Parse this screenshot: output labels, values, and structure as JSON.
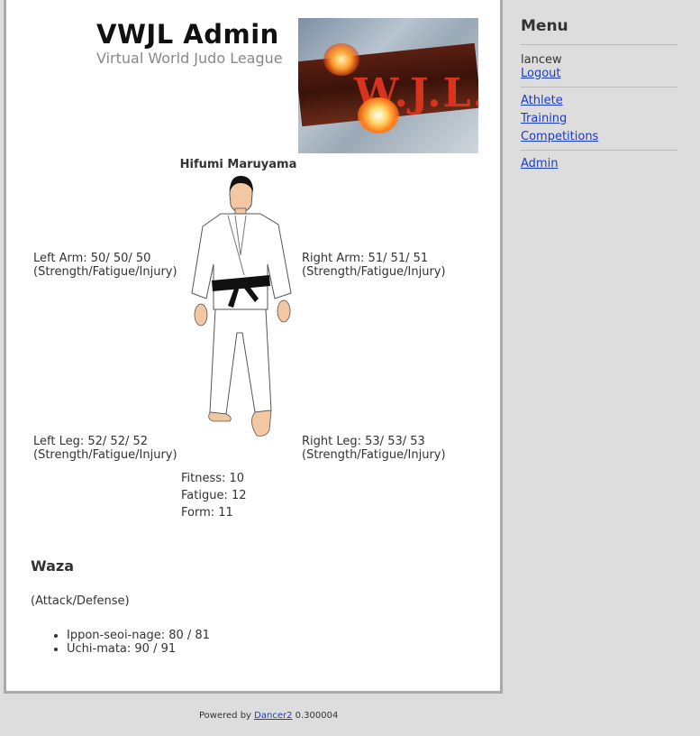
{
  "header": {
    "title": "VWJL Admin",
    "subtitle": "Virtual World Judo League",
    "logo_text": "VWJL"
  },
  "athlete": {
    "name": "Hifumi Maruyama",
    "left_arm": "Left Arm: 50/ 50/ 50",
    "right_arm": "Right Arm: 51/ 51/ 51",
    "left_leg": "Left Leg: 52/ 52/ 52",
    "right_leg": "Right Leg: 53/ 53/ 53",
    "stat_legend": "(Strength/Fatigue/Injury)",
    "fitness": "Fitness: 10",
    "fatigue": "Fatigue: 12",
    "form": "Form: 11"
  },
  "waza": {
    "heading": "Waza",
    "note": "(Attack/Defense)",
    "items": [
      "Ippon-seoi-nage: 80 / 81",
      "Uchi-mata: 90 / 91"
    ]
  },
  "sidebar": {
    "title": "Menu",
    "username": "lancew",
    "logout": "Logout",
    "links": [
      "Athlete",
      "Training",
      "Competitions"
    ],
    "admin": "Admin"
  },
  "footer": {
    "prefix": "Powered by",
    "link": "Dancer2",
    "version": "0.300004"
  },
  "colors": {
    "page_background": "#dddddd",
    "link": "#1a3ccc",
    "subtitle": "#888888"
  },
  "icons": {
    "logo": "vwjl-logo-image",
    "athlete_figure": "judoka-figure"
  }
}
